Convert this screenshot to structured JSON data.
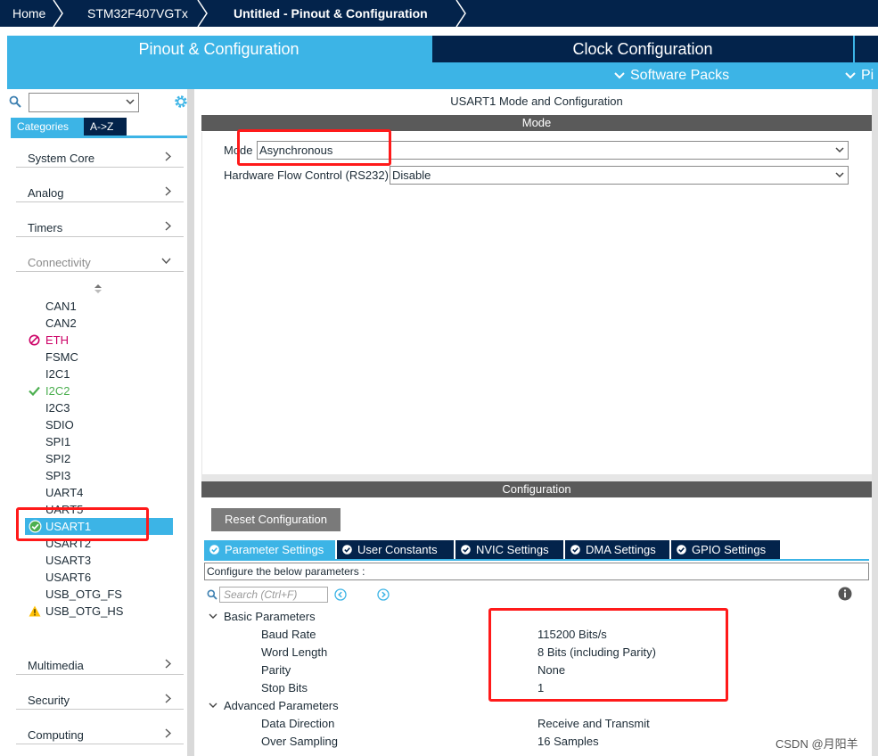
{
  "breadcrumb": {
    "home": "Home",
    "chip": "STM32F407VGTx",
    "project": "Untitled - Pinout & Configuration"
  },
  "top_tabs": {
    "pinout": "Pinout & Configuration",
    "clock": "Clock Configuration",
    "software_packs": "Software Packs",
    "more": "Pi"
  },
  "sidebar": {
    "tab_categories": "Categories",
    "tab_az": "A->Z",
    "categories": [
      "System Core",
      "Analog",
      "Timers",
      "Connectivity"
    ],
    "categories_bottom": [
      "Multimedia",
      "Security",
      "Computing"
    ],
    "peripherals": [
      {
        "name": "CAN1",
        "status": "none"
      },
      {
        "name": "CAN2",
        "status": "none"
      },
      {
        "name": "ETH",
        "status": "error"
      },
      {
        "name": "FSMC",
        "status": "none"
      },
      {
        "name": "I2C1",
        "status": "none"
      },
      {
        "name": "I2C2",
        "status": "ok"
      },
      {
        "name": "I2C3",
        "status": "none"
      },
      {
        "name": "SDIO",
        "status": "none"
      },
      {
        "name": "SPI1",
        "status": "none"
      },
      {
        "name": "SPI2",
        "status": "none"
      },
      {
        "name": "SPI3",
        "status": "none"
      },
      {
        "name": "UART4",
        "status": "none"
      },
      {
        "name": "UART5",
        "status": "none"
      },
      {
        "name": "USART1",
        "status": "selected"
      },
      {
        "name": "USART2",
        "status": "none"
      },
      {
        "name": "USART3",
        "status": "none"
      },
      {
        "name": "USART6",
        "status": "none"
      },
      {
        "name": "USB_OTG_FS",
        "status": "none"
      },
      {
        "name": "USB_OTG_HS",
        "status": "warning"
      }
    ]
  },
  "mode": {
    "title": "USART1 Mode and Configuration",
    "section": "Mode",
    "mode_label": "Mode",
    "mode_value": "Asynchronous",
    "flow_label": "Hardware Flow Control (RS232)",
    "flow_value": "Disable"
  },
  "config": {
    "section": "Configuration",
    "reset_button": "Reset Configuration",
    "tabs": [
      "Parameter Settings",
      "User Constants",
      "NVIC Settings",
      "DMA Settings",
      "GPIO Settings"
    ],
    "configure_text": "Configure the below parameters :",
    "search_placeholder": "Search (Ctrl+F)",
    "basic_group": "Basic Parameters",
    "advanced_group": "Advanced Parameters",
    "basic_params": [
      {
        "name": "Baud Rate",
        "value": "115200 Bits/s"
      },
      {
        "name": "Word Length",
        "value": "8 Bits (including Parity)"
      },
      {
        "name": "Parity",
        "value": "None"
      },
      {
        "name": "Stop Bits",
        "value": "1"
      }
    ],
    "advanced_params": [
      {
        "name": "Data Direction",
        "value": "Receive and Transmit"
      },
      {
        "name": "Over Sampling",
        "value": "16 Samples"
      }
    ]
  },
  "watermark": "CSDN @月阳羊",
  "colors": {
    "navy": "#03234b",
    "accent": "#3cb4e6",
    "ok": "#4caf50",
    "error": "#cc0066",
    "warning": "#ffc107",
    "annotation": "#ff1a1a"
  }
}
